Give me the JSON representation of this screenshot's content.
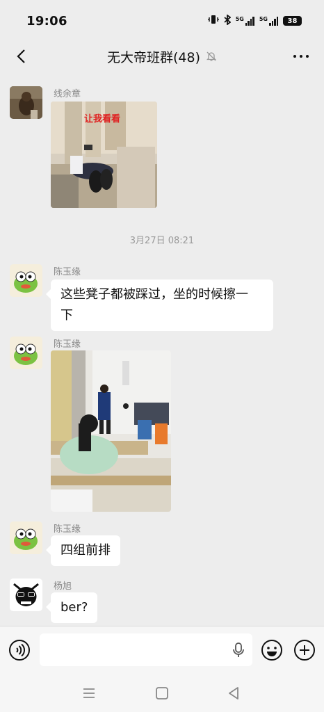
{
  "status_bar": {
    "time": "19:06",
    "signal_label_1": "5G",
    "signal_label_2": "5G",
    "battery": "38"
  },
  "header": {
    "title": "无大帝班群(48)"
  },
  "messages": [
    {
      "sender": "线余章",
      "type": "image",
      "image_caption": "让我看看"
    },
    {
      "type": "timestamp",
      "text": "3月27日 08:21"
    },
    {
      "sender": "陈玉缘",
      "type": "text",
      "text_line1": "这些凳子都被踩过，坐的时候擦一",
      "text_line2": "下"
    },
    {
      "sender": "陈玉缘",
      "type": "image"
    },
    {
      "sender": "陈玉缘",
      "type": "text",
      "text": "四组前排"
    },
    {
      "sender": "杨旭",
      "type": "text",
      "text": "ber?"
    }
  ],
  "input_bar": {
    "placeholder": ""
  },
  "colors": {
    "background": "#ededed",
    "bubble": "#ffffff",
    "sender_name": "#888888",
    "caption_red": "#e02020"
  }
}
